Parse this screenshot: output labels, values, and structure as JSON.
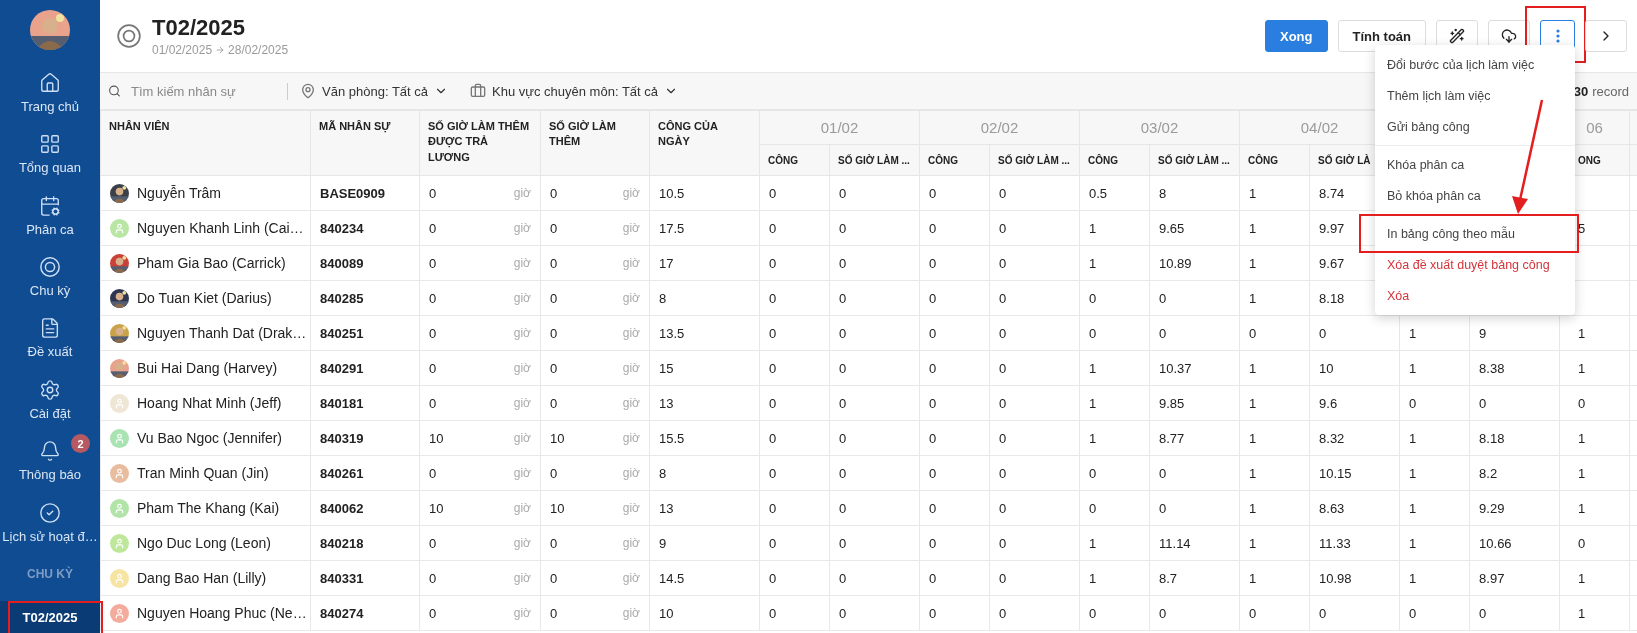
{
  "sidebar": {
    "avatar": {
      "kind": "picture"
    },
    "items": [
      {
        "label": "Trang chủ",
        "selected": false
      },
      {
        "label": "Tổng quan",
        "selected": false
      },
      {
        "label": "Phân ca",
        "selected": false
      },
      {
        "label": "Chu kỳ",
        "selected": false
      },
      {
        "label": "Đề xuất",
        "selected": false
      },
      {
        "label": "Cài đặt",
        "selected": false
      },
      {
        "label": "Thông báo",
        "selected": false,
        "badge": "2"
      },
      {
        "label": "Lịch sử hoạt đ…",
        "selected": false
      }
    ],
    "section_title": "CHU KỲ",
    "periods": [
      {
        "label": "T02/2025",
        "selected": true,
        "highlighted": true
      }
    ]
  },
  "header": {
    "title": "T02/2025",
    "start": "01/02/2025",
    "end": "28/02/2025",
    "buttons": [
      {
        "kind": "primary",
        "label": "Xong",
        "active": false,
        "highlighted": false
      },
      {
        "kind": "default",
        "label": "Tính toán",
        "active": false,
        "highlighted": false
      },
      {
        "kind": "icon",
        "active": false,
        "highlighted": false
      },
      {
        "kind": "icon",
        "active": false,
        "highlighted": false
      },
      {
        "kind": "icon",
        "active": true,
        "highlighted": true
      },
      {
        "kind": "icon",
        "active": false,
        "highlighted": false
      }
    ]
  },
  "toolbar": {
    "search": {
      "placeholder": "Tìm kiếm nhân sự"
    },
    "filters": [
      {
        "label": "Văn phòng: Tất cả"
      },
      {
        "label": "Khu vực chuyên môn: Tất cả"
      }
    ],
    "count": "30",
    "count_label": "record"
  },
  "menu": {
    "items": [
      {
        "label": "Đổi bước của lịch làm việc",
        "kind": "normal",
        "divider_before": false,
        "highlighted": false
      },
      {
        "label": "Thêm lịch làm việc",
        "kind": "normal",
        "divider_before": false,
        "highlighted": false
      },
      {
        "label": "Gửi bảng công",
        "kind": "normal",
        "divider_before": false,
        "highlighted": false
      },
      {
        "label": "Khóa phân ca",
        "kind": "normal",
        "divider_before": true,
        "highlighted": false
      },
      {
        "label": "Bỏ khóa phân ca",
        "kind": "normal",
        "divider_before": false,
        "highlighted": false
      },
      {
        "label": "In bảng công theo mẫu",
        "kind": "normal",
        "divider_before": true,
        "highlighted": true
      },
      {
        "label": "Xóa đề xuất duyệt bảng công",
        "kind": "danger",
        "divider_before": false,
        "highlighted": false
      },
      {
        "label": "Xóa",
        "kind": "danger",
        "divider_before": false,
        "highlighted": false
      }
    ]
  },
  "table": {
    "columns": [
      "NHÂN VIÊN",
      "MÃ NHÂN SỰ",
      "SỐ GIỜ LÀM THÊM ĐƯỢC TRẢ LƯƠNG",
      "SỐ GIỜ LÀM THÊM",
      "CÔNG CỦA NGÀY"
    ],
    "day_columns": [
      {
        "date": "01/02",
        "cong": "CÔNG",
        "hours": "SỐ GIỜ LÀM ..."
      },
      {
        "date": "02/02",
        "cong": "CÔNG",
        "hours": "SỐ GIỜ LÀM ..."
      },
      {
        "date": "03/02",
        "cong": "CÔNG",
        "hours": "SỐ GIỜ LÀM ..."
      },
      {
        "date": "04/02",
        "cong": "CÔNG",
        "hours": "SỐ GIỜ LÀ"
      }
    ],
    "last_day_column": {
      "date": "06",
      "cong": "ONG"
    },
    "rows": [
      {
        "name": "Nguyễn Trâm",
        "avatar": {
          "kind": "picture"
        },
        "code": "BASE0909",
        "ot_paid": {
          "value": "0",
          "unit": "giờ"
        },
        "ot": {
          "value": "0",
          "unit": "giờ"
        },
        "day_total": "10.5",
        "days": [
          {
            "cong": "0",
            "hours": "0"
          },
          {
            "cong": "0",
            "hours": "0"
          },
          {
            "cong": "0.5",
            "hours": "8"
          },
          {
            "cong": "1",
            "hours": "8.74"
          }
        ]
      },
      {
        "name": "Nguyen Khanh Linh (Cai…",
        "avatar": {
          "kind": "person",
          "color": "#b9e6a4"
        },
        "code": "840234",
        "ot_paid": {
          "value": "0",
          "unit": "giờ"
        },
        "ot": {
          "value": "0",
          "unit": "giờ"
        },
        "day_total": "17.5",
        "days": [
          {
            "cong": "0",
            "hours": "0"
          },
          {
            "cong": "0",
            "hours": "0"
          },
          {
            "cong": "1",
            "hours": "9.65"
          },
          {
            "cong": "1",
            "hours": "9.97"
          }
        ],
        "last_day": "5"
      },
      {
        "name": "Pham Gia Bao (Carrick)",
        "avatar": {
          "kind": "picture"
        },
        "code": "840089",
        "ot_paid": {
          "value": "0",
          "unit": "giờ"
        },
        "ot": {
          "value": "0",
          "unit": "giờ"
        },
        "day_total": "17",
        "days": [
          {
            "cong": "0",
            "hours": "0"
          },
          {
            "cong": "0",
            "hours": "0"
          },
          {
            "cong": "1",
            "hours": "10.89"
          },
          {
            "cong": "1",
            "hours": "9.67"
          }
        ]
      },
      {
        "name": "Do Tuan Kiet (Darius)",
        "avatar": {
          "kind": "picture"
        },
        "code": "840285",
        "ot_paid": {
          "value": "0",
          "unit": "giờ"
        },
        "ot": {
          "value": "0",
          "unit": "giờ"
        },
        "day_total": "8",
        "days": [
          {
            "cong": "0",
            "hours": "0"
          },
          {
            "cong": "0",
            "hours": "0"
          },
          {
            "cong": "0",
            "hours": "0"
          },
          {
            "cong": "1",
            "hours": "8.18"
          }
        ]
      },
      {
        "name": "Nguyen Thanh Dat (Drak…",
        "avatar": {
          "kind": "picture"
        },
        "code": "840251",
        "ot_paid": {
          "value": "0",
          "unit": "giờ"
        },
        "ot": {
          "value": "0",
          "unit": "giờ"
        },
        "day_total": "13.5",
        "days": [
          {
            "cong": "0",
            "hours": "0"
          },
          {
            "cong": "0",
            "hours": "0"
          },
          {
            "cong": "0",
            "hours": "0"
          },
          {
            "cong": "0",
            "hours": "0"
          },
          {
            "cong": "1",
            "hours": "9"
          }
        ],
        "last_day": "1"
      },
      {
        "name": "Bui Hai Dang (Harvey)",
        "avatar": {
          "kind": "picture"
        },
        "code": "840291",
        "ot_paid": {
          "value": "0",
          "unit": "giờ"
        },
        "ot": {
          "value": "0",
          "unit": "giờ"
        },
        "day_total": "15",
        "days": [
          {
            "cong": "0",
            "hours": "0"
          },
          {
            "cong": "0",
            "hours": "0"
          },
          {
            "cong": "1",
            "hours": "10.37"
          },
          {
            "cong": "1",
            "hours": "10"
          },
          {
            "cong": "1",
            "hours": "8.38"
          }
        ],
        "last_day": "1"
      },
      {
        "name": "Hoang Nhat Minh (Jeff)",
        "avatar": {
          "kind": "person",
          "color": "#efe6d6"
        },
        "code": "840181",
        "ot_paid": {
          "value": "0",
          "unit": "giờ"
        },
        "ot": {
          "value": "0",
          "unit": "giờ"
        },
        "day_total": "13",
        "days": [
          {
            "cong": "0",
            "hours": "0"
          },
          {
            "cong": "0",
            "hours": "0"
          },
          {
            "cong": "1",
            "hours": "9.85"
          },
          {
            "cong": "1",
            "hours": "9.6"
          },
          {
            "cong": "0",
            "hours": "0"
          }
        ],
        "last_day": "0"
      },
      {
        "name": "Vu Bao Ngoc (Jennifer)",
        "avatar": {
          "kind": "person",
          "color": "#a9e3b2"
        },
        "code": "840319",
        "ot_paid": {
          "value": "10",
          "unit": "giờ"
        },
        "ot": {
          "value": "10",
          "unit": "giờ"
        },
        "day_total": "15.5",
        "days": [
          {
            "cong": "0",
            "hours": "0"
          },
          {
            "cong": "0",
            "hours": "0"
          },
          {
            "cong": "1",
            "hours": "8.77"
          },
          {
            "cong": "1",
            "hours": "8.32"
          },
          {
            "cong": "1",
            "hours": "8.18"
          }
        ],
        "last_day": "1"
      },
      {
        "name": "Tran Minh Quan (Jin)",
        "avatar": {
          "kind": "person",
          "color": "#e8bc9e"
        },
        "code": "840261",
        "ot_paid": {
          "value": "0",
          "unit": "giờ"
        },
        "ot": {
          "value": "0",
          "unit": "giờ"
        },
        "day_total": "8",
        "days": [
          {
            "cong": "0",
            "hours": "0"
          },
          {
            "cong": "0",
            "hours": "0"
          },
          {
            "cong": "0",
            "hours": "0"
          },
          {
            "cong": "1",
            "hours": "10.15"
          },
          {
            "cong": "1",
            "hours": "8.2"
          }
        ],
        "last_day": "1"
      },
      {
        "name": "Pham The Khang (Kai)",
        "avatar": {
          "kind": "person",
          "color": "#b2e4a9"
        },
        "code": "840062",
        "ot_paid": {
          "value": "10",
          "unit": "giờ"
        },
        "ot": {
          "value": "10",
          "unit": "giờ"
        },
        "day_total": "13",
        "days": [
          {
            "cong": "0",
            "hours": "0"
          },
          {
            "cong": "0",
            "hours": "0"
          },
          {
            "cong": "0",
            "hours": "0"
          },
          {
            "cong": "1",
            "hours": "8.63"
          },
          {
            "cong": "1",
            "hours": "9.29"
          }
        ],
        "last_day": "1"
      },
      {
        "name": "Ngo Duc Long (Leon)",
        "avatar": {
          "kind": "person",
          "color": "#bfe79c"
        },
        "code": "840218",
        "ot_paid": {
          "value": "0",
          "unit": "giờ"
        },
        "ot": {
          "value": "0",
          "unit": "giờ"
        },
        "day_total": "9",
        "days": [
          {
            "cong": "0",
            "hours": "0"
          },
          {
            "cong": "0",
            "hours": "0"
          },
          {
            "cong": "1",
            "hours": "11.14"
          },
          {
            "cong": "1",
            "hours": "11.33"
          },
          {
            "cong": "1",
            "hours": "10.66"
          }
        ],
        "last_day": "0"
      },
      {
        "name": "Dang Bao Han (Lilly)",
        "avatar": {
          "kind": "person",
          "color": "#f6e4a2"
        },
        "code": "840331",
        "ot_paid": {
          "value": "0",
          "unit": "giờ"
        },
        "ot": {
          "value": "0",
          "unit": "giờ"
        },
        "day_total": "14.5",
        "days": [
          {
            "cong": "0",
            "hours": "0"
          },
          {
            "cong": "0",
            "hours": "0"
          },
          {
            "cong": "1",
            "hours": "8.7"
          },
          {
            "cong": "1",
            "hours": "10.98"
          },
          {
            "cong": "1",
            "hours": "8.97"
          }
        ],
        "last_day": "1"
      },
      {
        "name": "Nguyen Hoang Phuc (Ne…",
        "avatar": {
          "kind": "person",
          "color": "#f5ab9c"
        },
        "code": "840274",
        "ot_paid": {
          "value": "0",
          "unit": "giờ"
        },
        "ot": {
          "value": "0",
          "unit": "giờ"
        },
        "day_total": "10",
        "days": [
          {
            "cong": "0",
            "hours": "0"
          },
          {
            "cong": "0",
            "hours": "0"
          },
          {
            "cong": "0",
            "hours": "0"
          },
          {
            "cong": "0",
            "hours": "0"
          },
          {
            "cong": "0",
            "hours": "0"
          }
        ],
        "last_day": "1"
      }
    ]
  }
}
